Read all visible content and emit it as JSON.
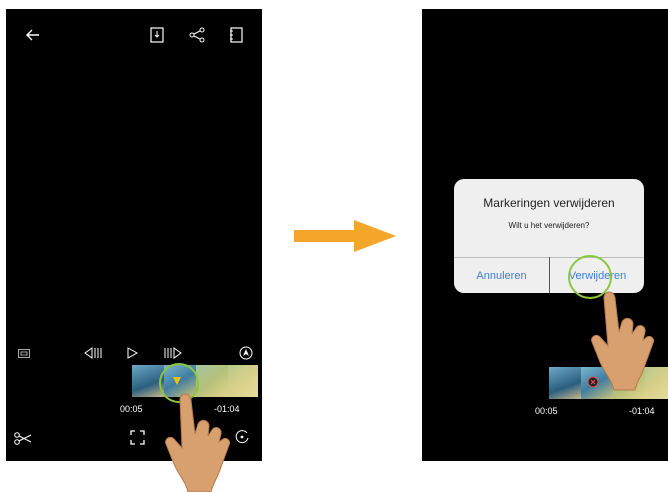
{
  "left_screen": {
    "time_current": "00:05",
    "time_remaining": "-01:04"
  },
  "right_screen": {
    "time_current": "00:05",
    "time_remaining": "-01:04",
    "dialog": {
      "title": "Markeringen verwijderen",
      "message": "Wilt u het verwijderen?",
      "cancel_label": "Annuleren",
      "confirm_label": "Verwijderen"
    }
  },
  "icons": {
    "back": "back-arrow-icon",
    "export": "export-icon",
    "share": "share-icon",
    "notebook": "notebook-icon",
    "aspect": "aspect-ratio-icon",
    "prev_frame": "previous-frame-icon",
    "play": "play-icon",
    "next_frame": "next-frame-icon",
    "navigate": "navigate-icon",
    "cut": "scissors-icon",
    "fullscreen": "fullscreen-icon",
    "rotate": "rotate-icon"
  },
  "colors": {
    "highlight_circle": "#8cc63f",
    "transition_arrow": "#f4a62a",
    "dialog_button": "#3b7fd0",
    "hand": "#d9a06f"
  }
}
